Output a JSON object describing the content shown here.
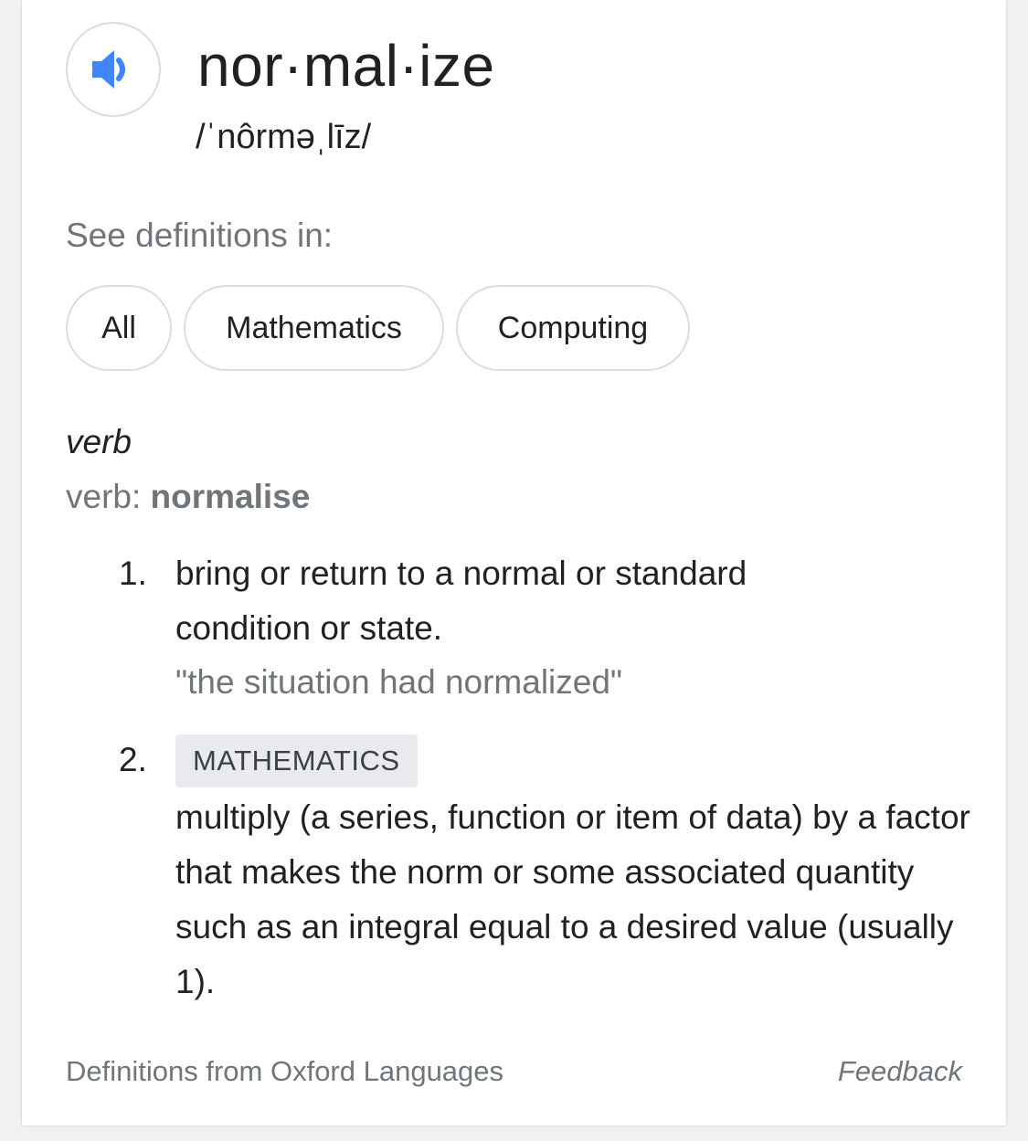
{
  "entry": {
    "headword": "nor·mal·ize",
    "pronunciation": "/ˈnôrməˌlīz/",
    "audio_icon": "speaker-icon",
    "accent_color": "#4285f4"
  },
  "see_definitions": {
    "label": "See definitions in:",
    "chips": [
      "All",
      "Mathematics",
      "Computing"
    ]
  },
  "part_of_speech": "verb",
  "variant": {
    "prefix": "verb: ",
    "word": "normalise"
  },
  "definitions": [
    {
      "number": "1.",
      "text": "bring or return to a normal or standard condition or state.",
      "example": "\"the situation had normalized\""
    },
    {
      "number": "2.",
      "label": "MATHEMATICS",
      "text": "multiply (a series, function or item of data) by a factor that makes the norm or some associated quantity such as an integral equal to a desired value (usually 1)."
    }
  ],
  "footer": {
    "source": "Definitions from Oxford Languages",
    "feedback": "Feedback"
  }
}
